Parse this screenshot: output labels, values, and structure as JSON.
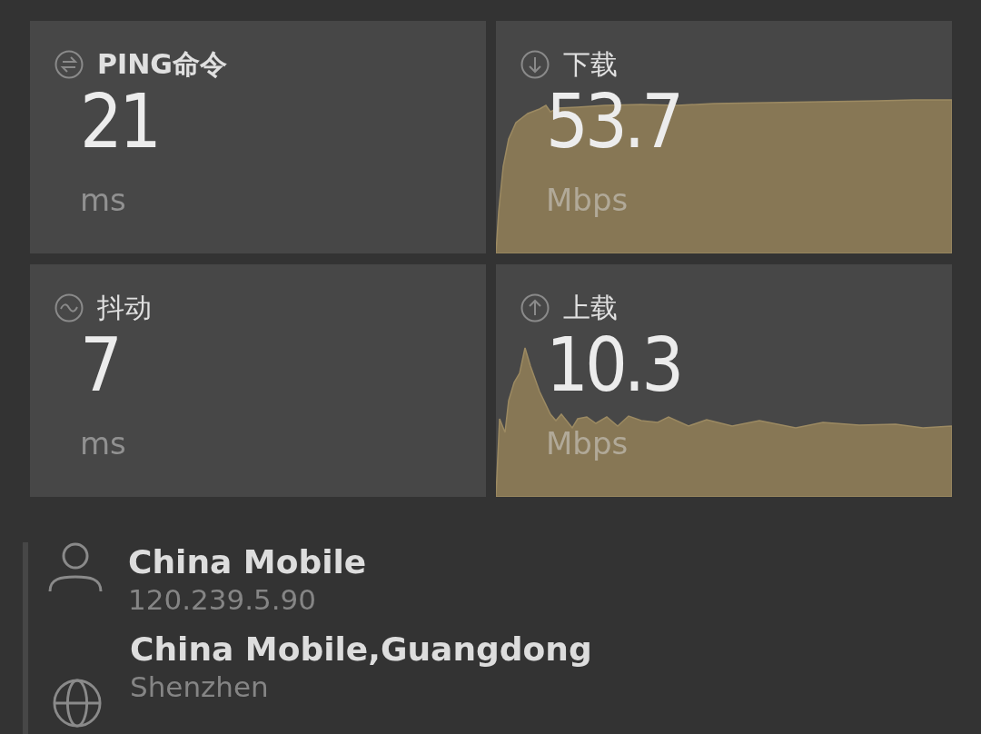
{
  "tiles": [
    {
      "kind": "ping",
      "label": "PING命令",
      "value": "21",
      "unit": "ms"
    },
    {
      "kind": "download",
      "label": "下载",
      "value": "53.7",
      "unit": "Mbps"
    },
    {
      "kind": "jitter",
      "label": "抖动",
      "value": "7",
      "unit": "ms"
    },
    {
      "kind": "upload",
      "label": "上载",
      "value": "10.3",
      "unit": "Mbps"
    }
  ],
  "server": {
    "provider": "China Mobile",
    "ip": "120.239.5.90",
    "host": "China Mobile,Guangdong",
    "city": "Shenzhen"
  }
}
